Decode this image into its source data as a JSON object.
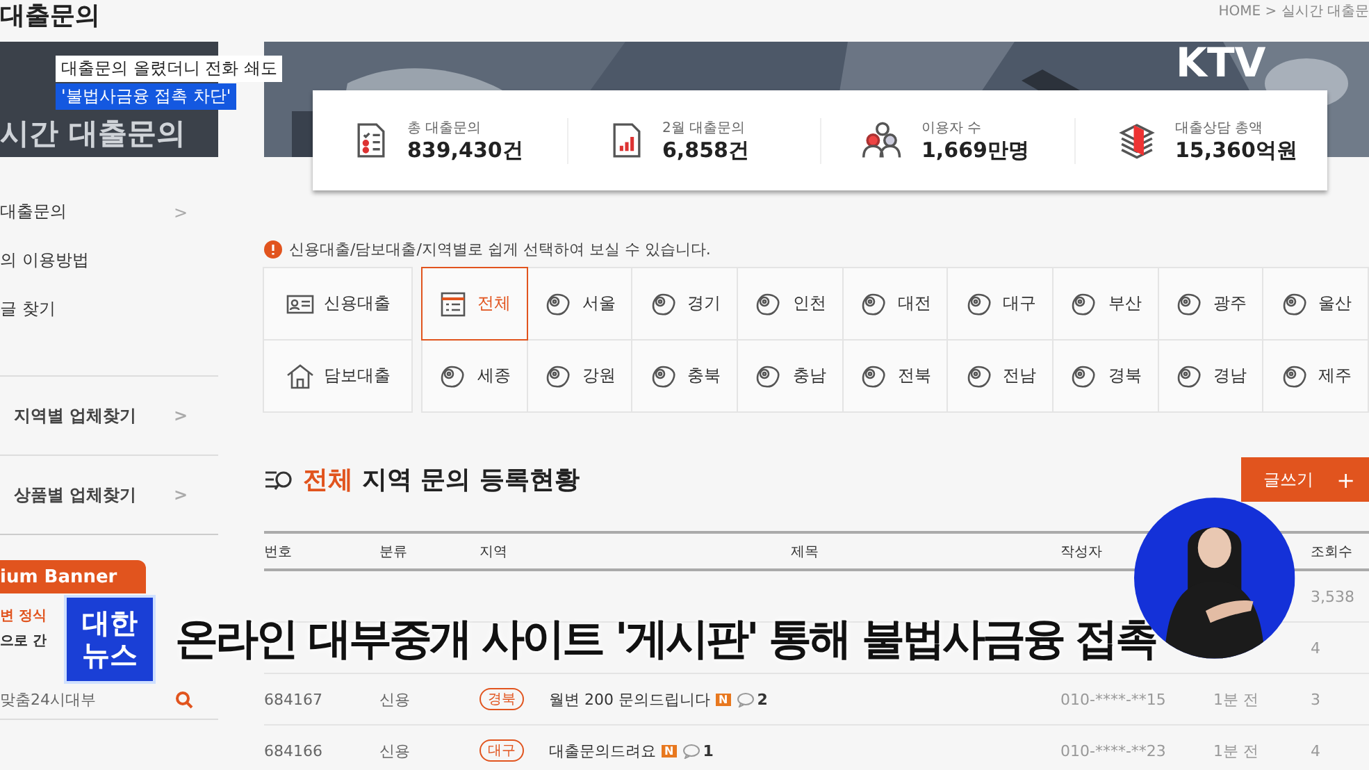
{
  "page_title": "대출문의",
  "breadcrumb": "HOME > 실시간 대출문",
  "banner": {
    "title": "시간 대출문의"
  },
  "stats": [
    {
      "kind": "checklist",
      "label": "총 대출문의",
      "value": "839,430건"
    },
    {
      "kind": "chart",
      "label": "2월 대출문의",
      "value": "6,858건"
    },
    {
      "kind": "people",
      "label": "이용자 수",
      "value": "1,669만명"
    },
    {
      "kind": "money",
      "label": "대출상담 총액",
      "value": "15,360억원"
    }
  ],
  "sidebar": {
    "items": [
      {
        "label": "대출문의",
        "arrow": ">"
      },
      {
        "label": "의 이용방법"
      },
      {
        "label": "글 찾기"
      }
    ],
    "finders": [
      {
        "label": "지역별 업체찾기",
        "arrow": ">"
      },
      {
        "label": "상품별 업체찾기",
        "arrow": ">"
      }
    ],
    "premium": {
      "title": "ium Banner",
      "lines": [
        "변 정식",
        "으로 간"
      ]
    },
    "search": {
      "value": "맞춤24시대부"
    }
  },
  "notice": "신용대출/담보대출/지역별로 쉽게 선택하여 보실 수 있습니다.",
  "filters": {
    "categories": [
      {
        "label": "신용대출",
        "kind": "card",
        "selected": false
      },
      {
        "label": "담보대출",
        "kind": "house",
        "selected": false
      }
    ],
    "regions": [
      {
        "label": "전체",
        "kind": "all",
        "selected": true
      },
      {
        "label": "서울",
        "kind": "region",
        "selected": false
      },
      {
        "label": "경기",
        "kind": "region",
        "selected": false
      },
      {
        "label": "인천",
        "kind": "region",
        "selected": false
      },
      {
        "label": "대전",
        "kind": "region",
        "selected": false
      },
      {
        "label": "대구",
        "kind": "region",
        "selected": false
      },
      {
        "label": "부산",
        "kind": "region",
        "selected": false
      },
      {
        "label": "광주",
        "kind": "region",
        "selected": false
      },
      {
        "label": "울산",
        "kind": "region",
        "selected": false
      },
      {
        "label": "세종",
        "kind": "region",
        "selected": false
      },
      {
        "label": "강원",
        "kind": "region",
        "selected": false
      },
      {
        "label": "충북",
        "kind": "region",
        "selected": false
      },
      {
        "label": "충남",
        "kind": "region",
        "selected": false
      },
      {
        "label": "전북",
        "kind": "region",
        "selected": false
      },
      {
        "label": "전남",
        "kind": "region",
        "selected": false
      },
      {
        "label": "경북",
        "kind": "region",
        "selected": false
      },
      {
        "label": "경남",
        "kind": "region",
        "selected": false
      },
      {
        "label": "제주",
        "kind": "region",
        "selected": false
      }
    ]
  },
  "section_heading": {
    "highlight": "전체",
    "rest": "지역 문의 등록현황"
  },
  "write_button": {
    "label": "글쓰기",
    "icon": "+"
  },
  "table": {
    "columns": [
      "번호",
      "분류",
      "지역",
      "제목",
      "작성자",
      "조회수"
    ],
    "rows": [
      {
        "views": "3,538"
      },
      {
        "views": "4"
      },
      {
        "number": "684167",
        "type": "신용",
        "region": "경북",
        "title": "월변 200 문의드립니다",
        "badge": "N",
        "comments": "2",
        "author": "010-****-**15",
        "time": "1분 전",
        "views": "3"
      },
      {
        "number": "684166",
        "type": "신용",
        "region": "대구",
        "title": "대출문의드려요",
        "badge": "N",
        "comments": "1",
        "author": "010-****-**23",
        "time": "1분 전",
        "views": "4"
      }
    ]
  },
  "news": {
    "caption_lines": [
      "대출문의 올렸더니 전화 쇄도",
      "'불법사금융 접촉 차단'"
    ],
    "channel": "KTV",
    "logo_lines": [
      "대한",
      "뉴스"
    ],
    "headline": "온라인 대부중개 사이트 '게시판' 통해 불법사금융 접촉"
  }
}
